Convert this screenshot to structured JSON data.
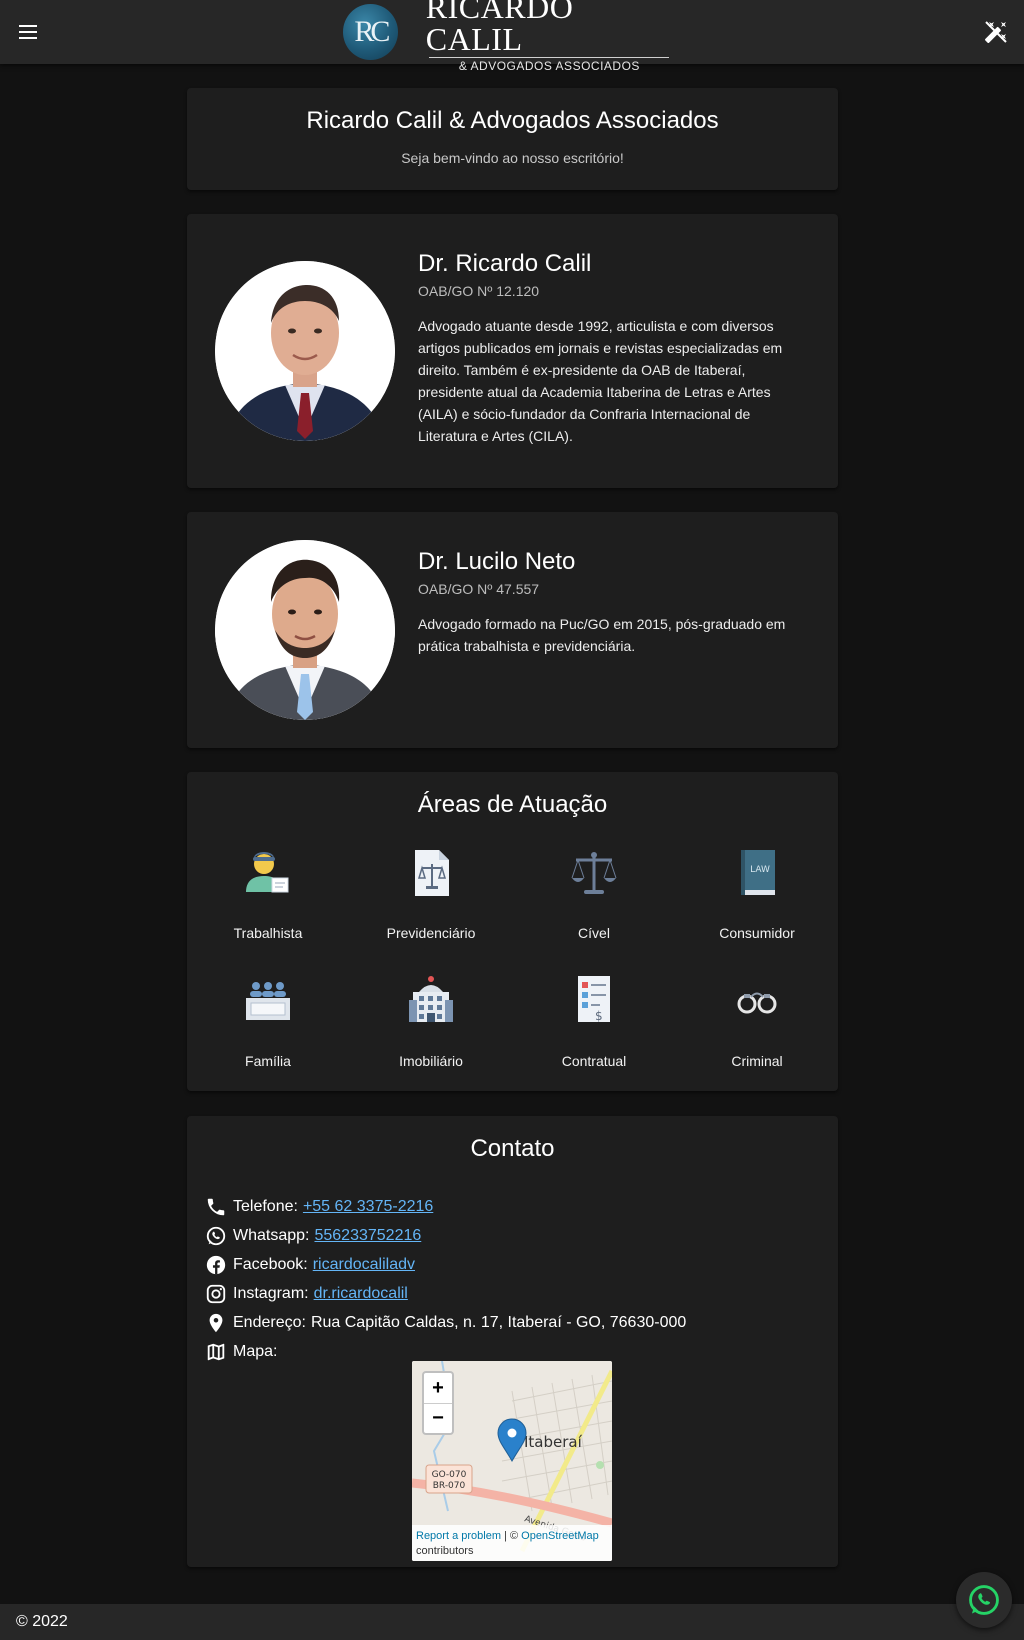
{
  "header": {
    "logo_badge": "RC",
    "logo_main": "RICARDO CALIL",
    "logo_sub": "& ADVOGADOS ASSOCIADOS"
  },
  "welcome": {
    "title": "Ricardo Calil & Advogados Associados",
    "subtitle": "Seja bem-vindo ao nosso escritório!"
  },
  "lawyers": [
    {
      "name": "Dr. Ricardo Calil",
      "oab": "OAB/GO Nº 12.120",
      "bio": "Advogado atuante desde 1992, articulista e com diversos artigos publicados em jornais e revistas especializadas em direito. Também é ex-presidente da OAB de Itaberaí, presidente atual da Academia Itaberina de Letras e Artes (AILA) e sócio-fundador da Confraria Internacional de Literatura e Artes (CILA)."
    },
    {
      "name": "Dr. Lucilo Neto",
      "oab": "OAB/GO Nº 47.557",
      "bio": "Advogado formado na Puc/GO em 2015, pós-graduado em prática trabalhista e previdenciária."
    }
  ],
  "areas": {
    "title": "Áreas de Atuação",
    "items": [
      {
        "label": "Trabalhista",
        "icon": "worker-icon"
      },
      {
        "label": "Previdenciário",
        "icon": "document-scale-icon"
      },
      {
        "label": "Cível",
        "icon": "scale-icon"
      },
      {
        "label": "Consumidor",
        "icon": "law-book-icon"
      },
      {
        "label": "Família",
        "icon": "family-icon"
      },
      {
        "label": "Imobiliário",
        "icon": "building-icon"
      },
      {
        "label": "Contratual",
        "icon": "contract-icon"
      },
      {
        "label": "Criminal",
        "icon": "handcuffs-icon"
      }
    ]
  },
  "contact": {
    "title": "Contato",
    "phone_label": "Telefone:",
    "phone": "+55 62 3375-2216",
    "whatsapp_label": "Whatsapp:",
    "whatsapp": "556233752216",
    "facebook_label": "Facebook:",
    "facebook": "ricardocaliladv",
    "instagram_label": "Instagram:",
    "instagram": "dr.ricardocalil",
    "address_label": "Endereço:",
    "address": "Rua Capitão Caldas, n. 17, Itaberaí - GO, 76630-000",
    "map_label": "Mapa:"
  },
  "map": {
    "zoom_in": "+",
    "zoom_out": "−",
    "city": "Itaberaí",
    "road_shield_1": "GO-070",
    "road_shield_2": "BR-070",
    "avenue": "Avenida Goiás",
    "report": "Report a problem",
    "attrib_sep": " | © ",
    "osm": "OpenStreetMap",
    "contributors": "contributors"
  },
  "footer": {
    "copyright": "© 2022"
  },
  "colors": {
    "background": "#121212",
    "surface": "#1e1e1e",
    "appbar": "#272727",
    "link": "#64b5f6",
    "whatsapp": "#25d366"
  }
}
